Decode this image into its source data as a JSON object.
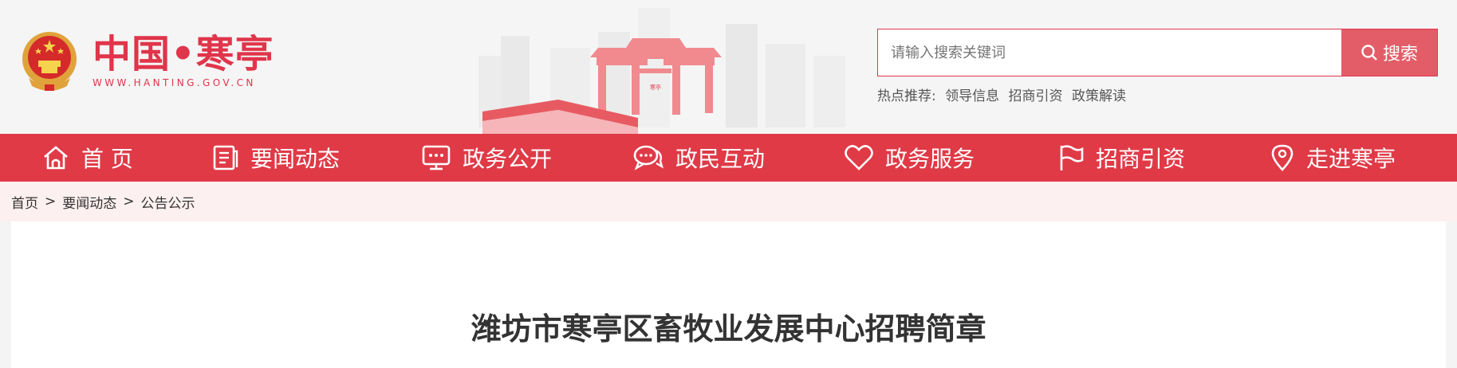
{
  "header": {
    "logo_title": "中国•寒亭",
    "logo_url": "WWW.HANTING.GOV.CN",
    "gate_sign": "寒亭"
  },
  "search": {
    "placeholder": "请输入搜索关键词",
    "button_label": "搜索",
    "hot_label": "热点推荐:",
    "hot_links": [
      "领导信息",
      "招商引资",
      "政策解读"
    ]
  },
  "nav": {
    "items": [
      {
        "label": "首 页",
        "icon": "home-icon"
      },
      {
        "label": "要闻动态",
        "icon": "news-icon"
      },
      {
        "label": "政务公开",
        "icon": "monitor-icon"
      },
      {
        "label": "政民互动",
        "icon": "chat-icon"
      },
      {
        "label": "政务服务",
        "icon": "heart-icon"
      },
      {
        "label": "招商引资",
        "icon": "flag-icon"
      },
      {
        "label": "走进寒亭",
        "icon": "location-pin-icon"
      }
    ]
  },
  "breadcrumb": {
    "items": [
      "首页",
      "要闻动态",
      "公告公示"
    ],
    "separator": ">"
  },
  "article": {
    "title": "潍坊市寒亭区畜牧业发展中心招聘简章"
  },
  "colors": {
    "brand_red": "#e03a47",
    "search_button": "#e35d68",
    "crumb_bg": "#fdf0f0"
  }
}
